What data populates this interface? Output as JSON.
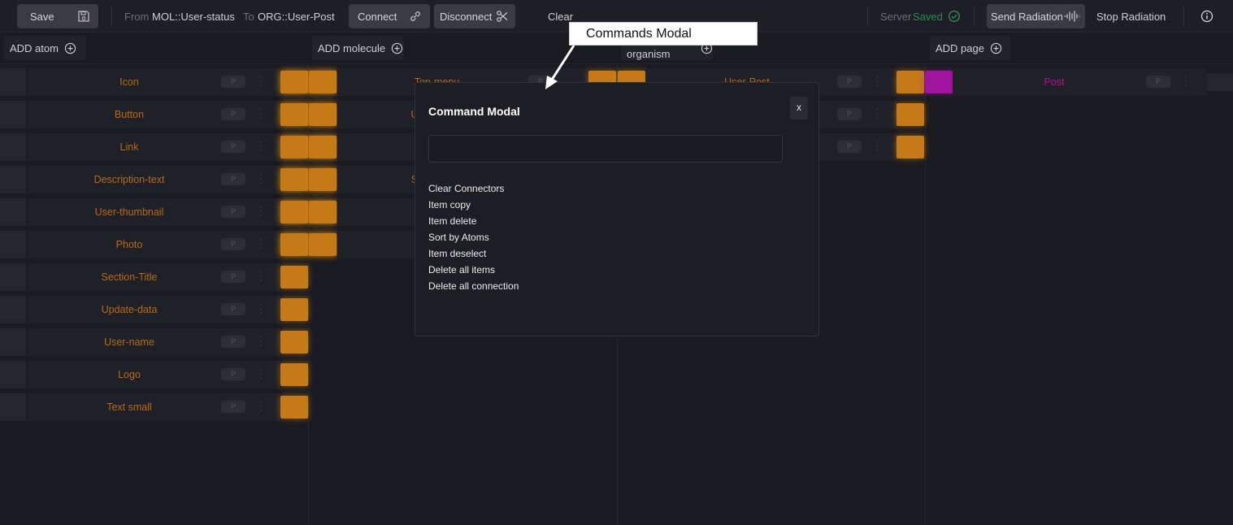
{
  "toolbar": {
    "save_label": "Save",
    "from_prefix": "From",
    "from_value": "MOL::User-status",
    "to_prefix": "To",
    "to_value": "ORG::User-Post",
    "connect_label": "Connect",
    "disconnect_label": "Disconnect",
    "clear_label": "Clear",
    "server_prefix": "Server",
    "server_status": "Saved",
    "send_radiation_label": "Send Radiation",
    "stop_radiation_label": "Stop Radiation"
  },
  "columns": {
    "atom": {
      "header": "ADD atom"
    },
    "molecule": {
      "header": "ADD molecule"
    },
    "organism": {
      "header": "ADD organism"
    },
    "page": {
      "header": "ADD page"
    }
  },
  "atoms": [
    {
      "label": "Icon",
      "badge": "P"
    },
    {
      "label": "Button",
      "badge": "P"
    },
    {
      "label": "Link",
      "badge": "P"
    },
    {
      "label": "Description-text",
      "badge": "P"
    },
    {
      "label": "User-thumbnail",
      "badge": "P"
    },
    {
      "label": "Photo",
      "badge": "P"
    },
    {
      "label": "Section-Title",
      "badge": "P"
    },
    {
      "label": "Update-data",
      "badge": "P"
    },
    {
      "label": "User-name",
      "badge": "P"
    },
    {
      "label": "Logo",
      "badge": "P"
    },
    {
      "label": "Text small",
      "badge": "P"
    }
  ],
  "molecules": [
    {
      "label": "Top-menu",
      "badge": "P"
    },
    {
      "label": "U",
      "badge": ""
    },
    {
      "label": "",
      "badge": ""
    },
    {
      "label": "S",
      "badge": ""
    },
    {
      "label": "",
      "badge": ""
    },
    {
      "label": "",
      "badge": ""
    }
  ],
  "organisms": [
    {
      "label": "User-Post",
      "badge": "P"
    },
    {
      "label": "",
      "badge": "P"
    },
    {
      "label": "",
      "badge": "P"
    }
  ],
  "pages": [
    {
      "label": "Post",
      "badge": "P"
    }
  ],
  "modal": {
    "title": "Command Modal",
    "close_label": "x",
    "input_value": "",
    "commands": [
      "Clear Connectors",
      "Item copy",
      "Item delete",
      "Sort by Atoms",
      "Item deselect",
      "Delete all items",
      "Delete all connection"
    ]
  },
  "annotation": {
    "text": "Commands Modal"
  },
  "colors": {
    "background": "#1a1b21",
    "atom_label": "#b86a14",
    "connector": "#c57a17",
    "page_label": "#b0109a",
    "page_connector": "#a0139d",
    "saved_green": "#2e8a5a"
  }
}
